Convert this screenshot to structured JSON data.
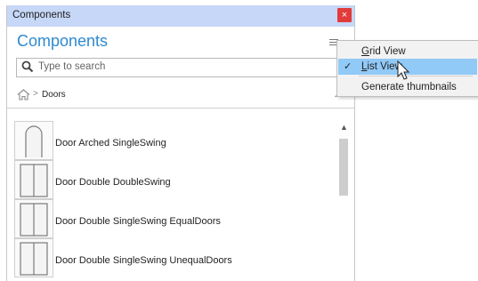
{
  "window": {
    "title": "Components",
    "close_glyph": "×"
  },
  "panel": {
    "heading": "Components",
    "menu_icon": "hamburger-icon"
  },
  "search": {
    "placeholder": "Type to search",
    "value": "",
    "icon": "search-icon"
  },
  "breadcrumb": {
    "home_icon": "home-icon",
    "separator": ">",
    "items": [
      "Doors"
    ],
    "back_icon": "back-arrow-icon"
  },
  "list": {
    "items": [
      {
        "label": "Door Arched SingleSwing",
        "thumb": "arched-door-icon"
      },
      {
        "label": "Door Double DoubleSwing",
        "thumb": "double-door-icon"
      },
      {
        "label": "Door Double SingleSwing EqualDoors",
        "thumb": "double-door-icon"
      },
      {
        "label": "Door Double SingleSwing UnequalDoors",
        "thumb": "double-door-icon"
      }
    ]
  },
  "context_menu": {
    "items": [
      {
        "label": "Grid View",
        "access_key": "G",
        "rest": "rid View",
        "checked": false,
        "highlighted": false
      },
      {
        "label": "List View",
        "access_key": "L",
        "rest": "ist View",
        "checked": true,
        "highlighted": true
      },
      {
        "label": "Generate thumbnails",
        "checked": false,
        "highlighted": false
      }
    ],
    "check_glyph": "✓"
  },
  "colors": {
    "titlebar": "#c6d7f7",
    "heading": "#2e8ad0",
    "close": "#e23b3b",
    "menu_highlight": "#91c9f7"
  }
}
